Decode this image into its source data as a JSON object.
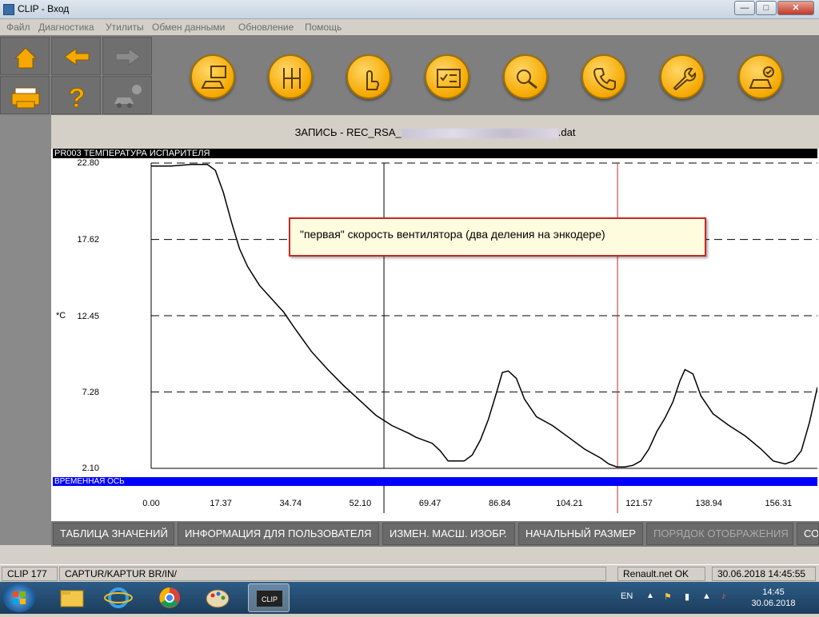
{
  "window": {
    "title": "CLIP - Вход"
  },
  "menu": [
    "Файл",
    "Диагностика",
    "Утилиты",
    "Обмен данными",
    "Обновление",
    "Помощь"
  ],
  "toolbar": {
    "left_buttons": [
      "home-icon",
      "arrow-left-icon",
      "arrow-right-icon",
      "printer-icon",
      "help-icon",
      "vehicle-info-icon"
    ],
    "orb_buttons": [
      "vehicle-id-icon",
      "gearbox-icon",
      "touch-icon",
      "checklist-icon",
      "diagnostic-icon",
      "phone-support-icon",
      "wrench-icon",
      "vehicle-check-icon"
    ]
  },
  "record": {
    "title_prefix": "ЗАПИСЬ - REC_RSA_",
    "title_suffix": ".dat"
  },
  "parameter": {
    "label": "PR003  ТЕМПЕРАТУРА ИСПАРИТЕЛЯ",
    "unit": "*C"
  },
  "time_axis_label": "ВРЕМЕННАЯ ОСЬ",
  "callout": "\"первая\" скорость вентилятора (два деления на энкодере)",
  "chart_data": {
    "type": "line",
    "title": "PR003  ТЕМПЕРАТУРА ИСПАРИТЕЛЯ",
    "ylabel": "*C",
    "xlabel": "ВРЕМЕННАЯ ОСЬ",
    "ylim": [
      2.1,
      22.8
    ],
    "xlim": [
      0.0,
      166.0
    ],
    "yticks": [
      "22.80",
      "17.62",
      "12.45",
      "7.28",
      "2.10"
    ],
    "xticks": [
      "0.00",
      "17.37",
      "34.74",
      "52.10",
      "69.47",
      "86.84",
      "104.21",
      "121.57",
      "138.94",
      "156.31"
    ],
    "cursors": [
      {
        "x": 58.0,
        "color": "#000000"
      },
      {
        "x": 116.2,
        "color": "#c62828"
      }
    ],
    "series": [
      {
        "x": [
          0,
          5,
          10,
          14,
          16,
          18,
          20,
          22,
          24,
          27,
          30,
          33,
          36,
          40,
          44,
          48,
          52,
          56,
          60,
          64,
          66,
          70,
          72,
          74,
          76,
          78,
          80,
          82,
          84,
          86,
          87.5,
          89,
          91,
          93,
          96,
          100,
          104,
          108,
          112,
          114,
          116,
          118,
          120,
          122,
          124,
          126,
          128,
          130,
          131.7,
          133,
          135,
          137,
          140,
          144,
          148,
          152,
          155,
          158,
          160,
          162,
          164,
          166
        ],
        "y": [
          22.6,
          22.6,
          22.7,
          22.7,
          22.3,
          20.8,
          18.8,
          17.0,
          15.8,
          14.5,
          13.6,
          12.7,
          11.5,
          10.0,
          8.8,
          7.7,
          6.7,
          5.7,
          5.0,
          4.5,
          4.2,
          3.8,
          3.3,
          2.6,
          2.6,
          2.6,
          3.0,
          4.0,
          5.4,
          7.2,
          8.6,
          8.7,
          8.2,
          6.8,
          5.6,
          5.0,
          4.2,
          3.4,
          2.8,
          2.4,
          2.2,
          2.2,
          2.3,
          2.6,
          3.4,
          4.6,
          5.5,
          6.6,
          8.0,
          8.8,
          8.5,
          7.0,
          5.8,
          5.0,
          4.3,
          3.4,
          2.6,
          2.4,
          2.6,
          3.3,
          5.2,
          7.6
        ]
      }
    ]
  },
  "bottom_buttons": [
    {
      "label": "ТАБЛИЦА ЗНАЧЕНИЙ",
      "enabled": true
    },
    {
      "label": "ИНФОРМАЦИЯ ДЛЯ ПОЛЬЗОВАТЕЛЯ",
      "enabled": true
    },
    {
      "label": "ИЗМЕН. МАСШ. ИЗОБР.",
      "enabled": true
    },
    {
      "label": "НАЧАЛЬНЫЙ РАЗМЕР",
      "enabled": true
    },
    {
      "label": "ПОРЯДОК ОТОБРАЖЕНИЯ",
      "enabled": false
    },
    {
      "label": "СО",
      "enabled": true
    }
  ],
  "status": {
    "version": "CLIP 177",
    "vehicle": "CAPTUR/KAPTUR BR/IN/",
    "network": "Renault.net OK",
    "datetime": "30.06.2018 14:45:55"
  },
  "taskbar": {
    "lang": "EN",
    "time": "14:45",
    "date": "30.06.2018",
    "apps": [
      "explorer-icon",
      "internet-explorer-icon",
      "chrome-icon",
      "paint-icon",
      "clip-app-icon"
    ],
    "active_app": 4
  }
}
